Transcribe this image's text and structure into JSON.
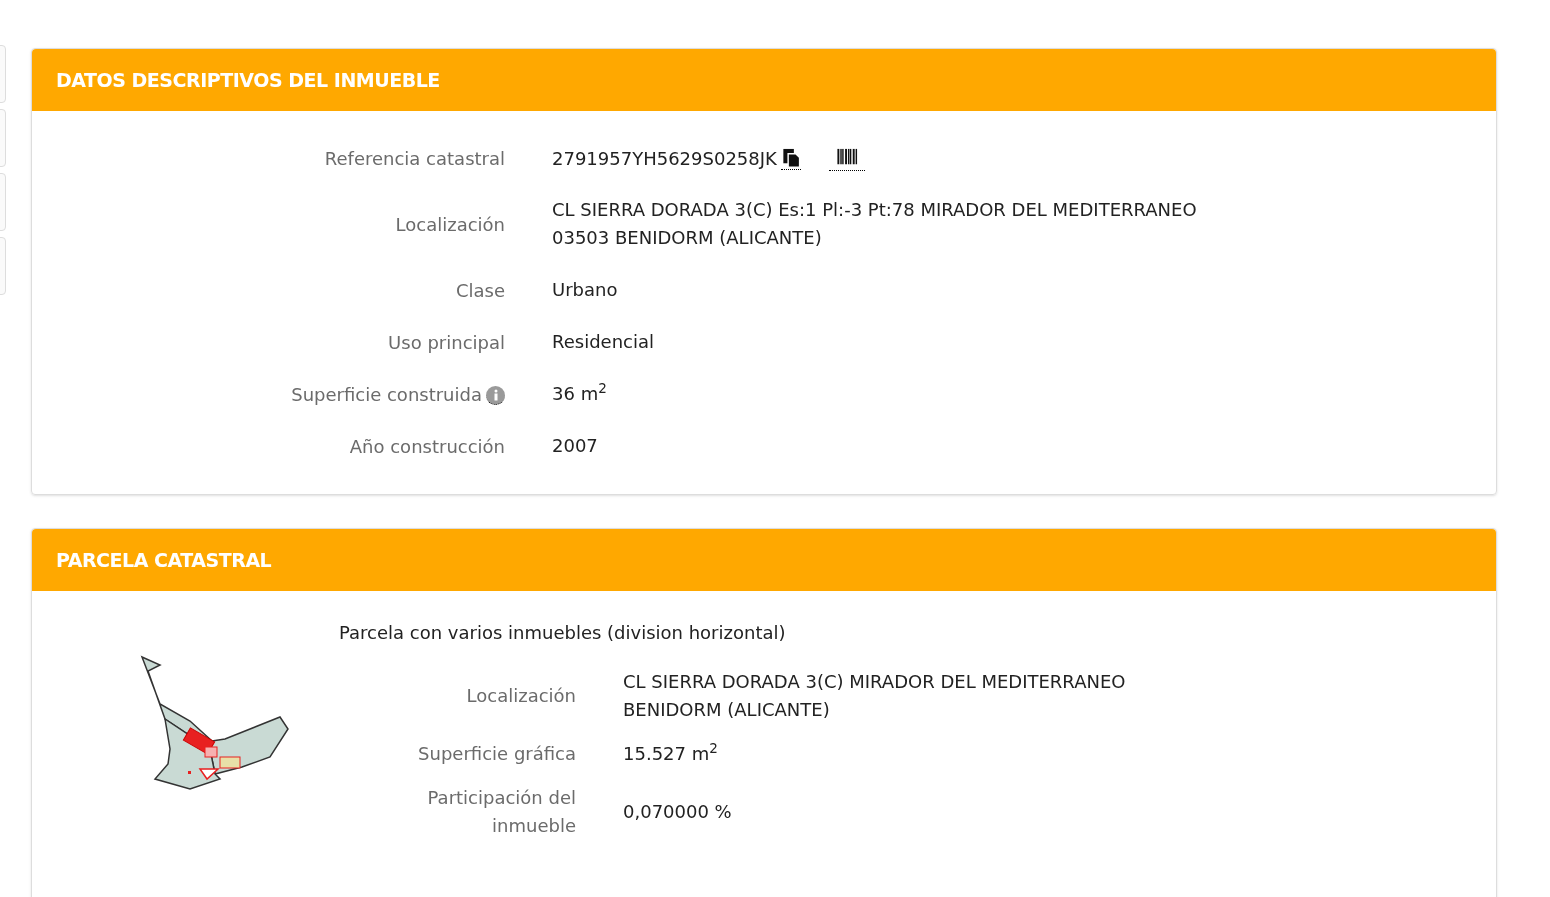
{
  "inmueble": {
    "title": "DATOS DESCRIPTIVOS DEL INMUEBLE",
    "rows": [
      {
        "kind": "reference",
        "label": "Referencia catastral",
        "value": "2791957YH5629S0258JK"
      },
      {
        "kind": "text",
        "label": "Localización",
        "lines": [
          "CL SIERRA DORADA 3(C) Es:1 Pl:-3 Pt:78 MIRADOR DEL MEDITERRANEO",
          "03503 BENIDORM (ALICANTE)"
        ]
      },
      {
        "kind": "text",
        "label": "Clase",
        "lines": [
          "Urbano"
        ]
      },
      {
        "kind": "text",
        "label": "Uso principal",
        "lines": [
          "Residencial"
        ]
      },
      {
        "kind": "info",
        "label": "Superficie construida",
        "lines": [
          "36 m$^{2}$"
        ]
      },
      {
        "kind": "text",
        "label": "Año construcción",
        "lines": [
          "2007"
        ]
      }
    ]
  },
  "parcela": {
    "title": "PARCELA CATASTRAL",
    "subtitle": "Parcela con varios inmuebles (division horizontal)",
    "rows": [
      {
        "label": [
          "Localización"
        ],
        "lines": [
          "CL SIERRA DORADA 3(C) MIRADOR DEL MEDITERRANEO",
          "BENIDORM (ALICANTE)"
        ]
      },
      {
        "label": [
          "Superficie gráfica"
        ],
        "lines": [
          "15.527 m$^{2}$"
        ]
      },
      {
        "label": [
          "Participación del",
          "inmueble"
        ],
        "lines": [
          "0,070000 %"
        ]
      }
    ]
  }
}
